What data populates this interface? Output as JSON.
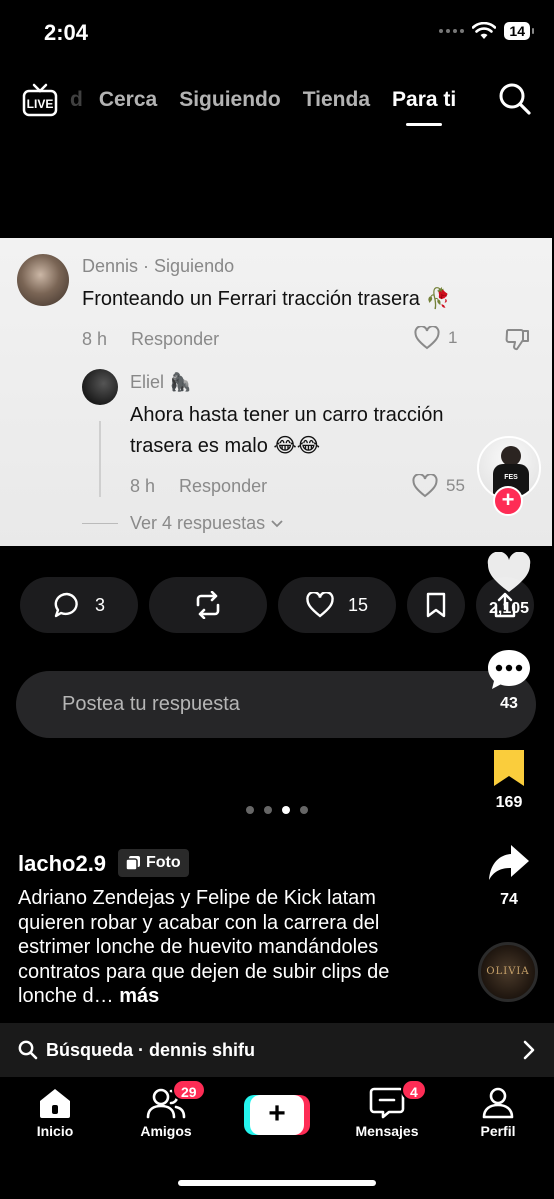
{
  "status_bar": {
    "time": "2:04",
    "battery": "14"
  },
  "top_nav": {
    "partial_tab": "d",
    "tabs": [
      "Cerca",
      "Siguiendo",
      "Tienda",
      "Para ti"
    ],
    "active_tab": "Para ti",
    "live_label": "LIVE"
  },
  "comment": {
    "author": "Dennis",
    "relation": "Siguiendo",
    "text": "Fronteando un Ferrari tracción trasera 🥀",
    "time": "8 h",
    "reply_label": "Responder",
    "likes": "1"
  },
  "reply": {
    "author": "Eliel 🦍",
    "text": "Ahora hasta tener un carro tracción trasera es malo 😂😂",
    "time": "8 h",
    "reply_label": "Responder",
    "likes": "55"
  },
  "view_replies": "Ver 4 respuestas",
  "creator_shirt": "FES",
  "actions": {
    "comments": "3",
    "reposts": "",
    "likes": "15"
  },
  "reply_input_placeholder": "Postea tu respuesta",
  "right_rail": {
    "likes": "2,105",
    "comments": "43",
    "saves": "169",
    "shares": "74",
    "save_color": "#facd3c"
  },
  "post": {
    "username": "lacho2.9",
    "type_badge": "Foto",
    "caption": "Adriano Zendejas y Felipe de Kick latam quieren robar y acabar con la carrera del estrimer lonche de huevito mandándoles contratos para que dejen de subir clips de lonche d…",
    "more": "más",
    "music_label": "OLIVIA",
    "page_count": 4,
    "page_current": 3
  },
  "search_suggestion": "Búsqueda · dennis shifu",
  "bottom_nav": {
    "home": "Inicio",
    "friends": "Amigos",
    "friends_badge": "29",
    "messages": "Mensajes",
    "messages_badge": "4",
    "profile": "Perfil"
  },
  "colors": {
    "accent_red": "#fe2c55",
    "accent_cyan": "#25f4ee",
    "card_bg": "#efefef"
  }
}
